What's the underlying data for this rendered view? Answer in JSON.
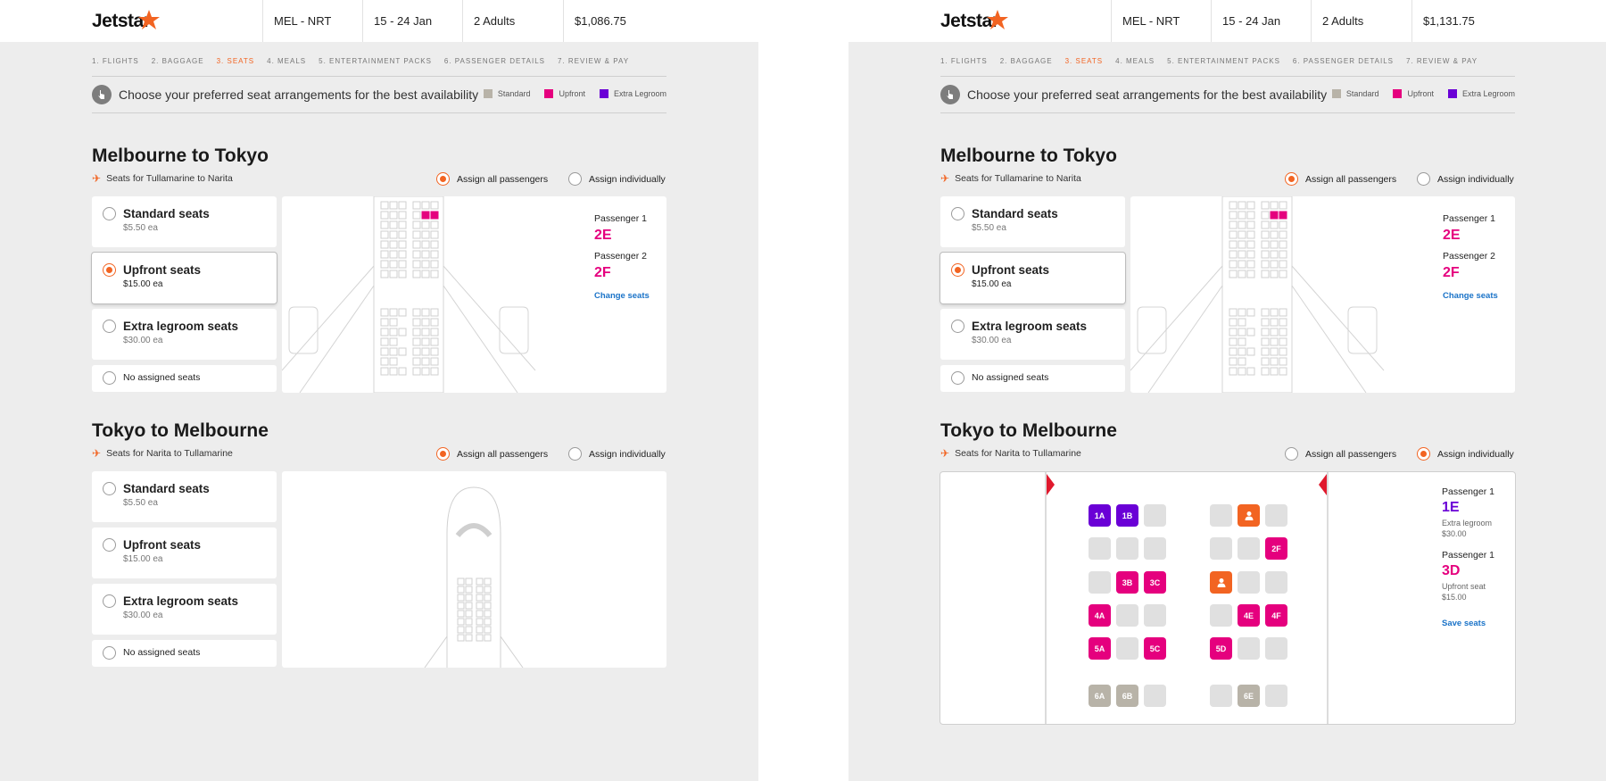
{
  "left": {
    "header": {
      "route": "MEL - NRT",
      "dates": "15 - 24 Jan",
      "pax": "2 Adults",
      "price": "$1,086.75"
    },
    "seg2_mode": "all"
  },
  "right": {
    "header": {
      "route": "MEL - NRT",
      "dates": "15 - 24 Jan",
      "pax": "2 Adults",
      "price": "$1,131.75"
    },
    "seg2_mode": "individual"
  },
  "brand": {
    "logo": "Jetstar",
    "accent": "#f26422",
    "upfront": "#e5007e",
    "extra": "#6a00d6",
    "standard": "#b8b3a8"
  },
  "steps": [
    "1. FLIGHTS",
    "2. BAGGAGE",
    "3. SEATS",
    "4. MEALS",
    "5. ENTERTAINMENT PACKS",
    "6. PASSENGER DETAILS",
    "7. REVIEW & PAY"
  ],
  "info": {
    "text": "Choose your preferred seat arrangements for the best availability",
    "legend": [
      "Standard",
      "Upfront",
      "Extra Legroom"
    ]
  },
  "segment1": {
    "title": "Melbourne to Tokyo",
    "subtitle": "Seats for Tullamarine to Narita",
    "assign_all": "Assign all passengers",
    "assign_individually": "Assign individually",
    "passengers": [
      {
        "label": "Passenger 1",
        "seat": "2E"
      },
      {
        "label": "Passenger 2",
        "seat": "2F"
      }
    ],
    "change_seats": "Change seats"
  },
  "segment2": {
    "title": "Tokyo to Melbourne",
    "subtitle": "Seats for Narita to Tullamarine",
    "assign_all": "Assign all passengers",
    "assign_individually": "Assign individually",
    "passengers": [
      {
        "label": "Passenger 1",
        "seat": "1E",
        "type": "Extra legroom",
        "price": "$30.00"
      },
      {
        "label": "Passenger 1",
        "seat": "3D",
        "type": "Upfront seat",
        "price": "$15.00"
      }
    ],
    "save_seats": "Save seats"
  },
  "options": [
    {
      "name": "Standard seats",
      "price": "$5.50 ea"
    },
    {
      "name": "Upfront seats",
      "price": "$15.00 ea"
    },
    {
      "name": "Extra legroom seats",
      "price": "$30.00 ea"
    },
    {
      "name": "No assigned seats"
    }
  ],
  "seat_grid": [
    [
      "1A",
      "1B",
      "",
      "",
      "occ",
      ""
    ],
    [
      "",
      "",
      "",
      "",
      "",
      "2F"
    ],
    [
      "",
      "3B",
      "3C",
      "occ",
      "",
      ""
    ],
    [
      "4A",
      "",
      "",
      "",
      "4E",
      "4F"
    ],
    [
      "5A",
      "",
      "5C",
      "5D",
      "",
      ""
    ],
    [
      "6A",
      "6B",
      "",
      "",
      "6E",
      ""
    ]
  ]
}
